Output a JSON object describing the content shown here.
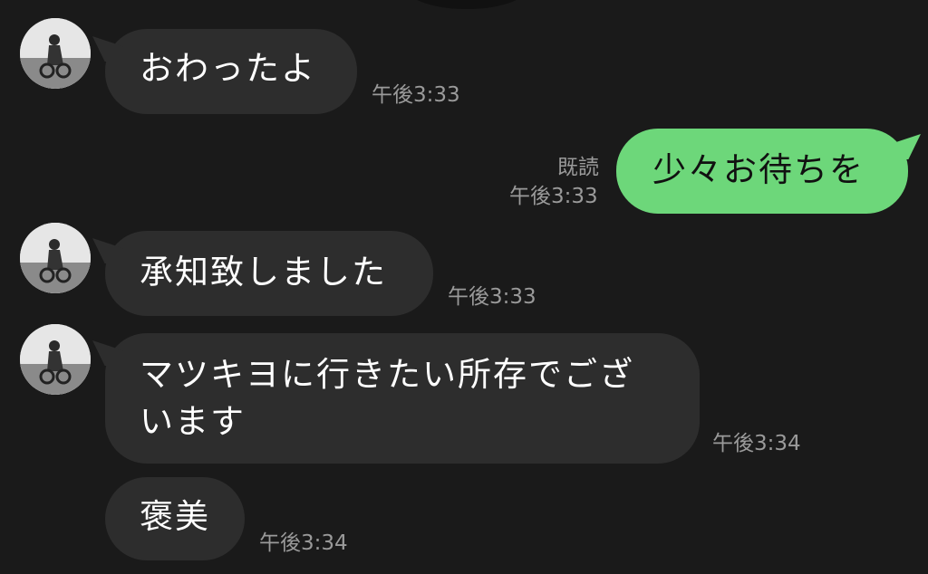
{
  "messages": [
    {
      "side": "in",
      "text": "おわったよ",
      "time": "午後3:33",
      "has_avatar": true
    },
    {
      "side": "out",
      "text": "少々お待ちを",
      "time": "午後3:33",
      "read": "既読"
    },
    {
      "side": "in",
      "text": "承知致しました",
      "time": "午後3:33",
      "has_avatar": true
    },
    {
      "side": "in",
      "text": "マツキヨに行きたい所存でございます",
      "time": "午後3:34",
      "has_avatar": true
    },
    {
      "side": "in",
      "text": "褒美",
      "time": "午後3:34",
      "has_avatar": false
    }
  ],
  "colors": {
    "background": "#1a1a1a",
    "incoming_bubble": "#2d2d2d",
    "outgoing_bubble": "#6dd77a",
    "timestamp": "#9a9a9a"
  },
  "icons": {
    "avatar": "avatar-icon"
  }
}
